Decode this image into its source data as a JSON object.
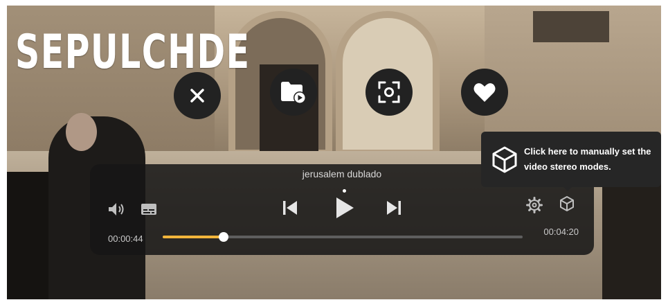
{
  "overlay_title": "SEPULCHDE",
  "top_buttons": {
    "close_icon": "close-icon",
    "folder_icon": "folder-play-icon",
    "recenter_icon": "recenter-view-icon",
    "favorite_icon": "heart-icon"
  },
  "player": {
    "title": "jerusalem dublado",
    "current_time": "00:00:44",
    "total_time": "00:04:20",
    "progress": 0.17,
    "accent_color": "#f2b53b",
    "controls": {
      "volume_icon": "volume-icon",
      "subtitles_icon": "subtitles-icon",
      "previous_icon": "skip-previous-icon",
      "play_icon": "play-icon",
      "next_icon": "skip-next-icon",
      "settings_icon": "gear-icon",
      "stereo_icon": "cube-icon"
    }
  },
  "tooltip": {
    "text": "Click here to manually set the video stereo modes.",
    "icon": "cube-icon"
  }
}
